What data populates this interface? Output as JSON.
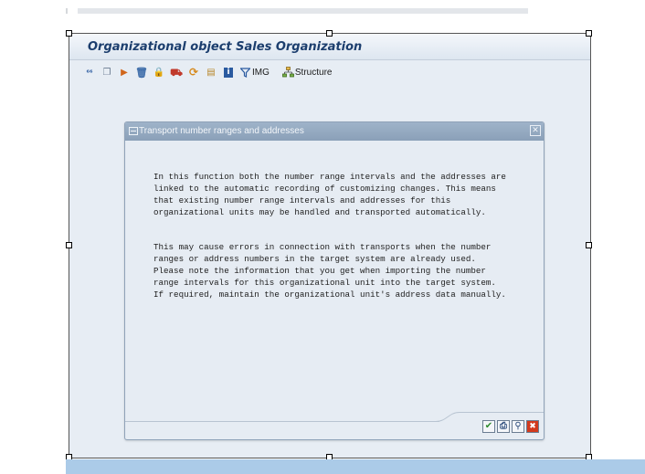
{
  "window": {
    "title": "Organizational object Sales Organization"
  },
  "toolbar": {
    "buttons": [
      {
        "icon": "display-change-icon",
        "glyph": "⁶⁶"
      },
      {
        "icon": "copy-icon",
        "glyph": "❐"
      },
      {
        "icon": "transport-icon",
        "glyph": "▶"
      },
      {
        "icon": "delete-icon",
        "glyph": "🗑"
      },
      {
        "icon": "lock-icon",
        "glyph": "🔒"
      },
      {
        "icon": "transport-truck-icon",
        "glyph": "⛟"
      },
      {
        "icon": "refresh-icon",
        "glyph": "⟳"
      },
      {
        "icon": "document-icon",
        "glyph": "▤"
      },
      {
        "icon": "info-icon",
        "glyph": "i"
      }
    ],
    "img_label": "IMG",
    "structure_label": "Structure"
  },
  "dialog": {
    "title": "Transport number ranges and addresses",
    "close_glyph": "✕",
    "paragraph1": [
      "In this function both the number range intervals and the addresses are",
      "linked to the automatic recording of customizing changes. This means",
      "that existing number range intervals and addresses for this",
      "organizational units may be handled and transported automatically."
    ],
    "paragraph2": [
      "This may cause errors in connection with transports when the number",
      "ranges or address numbers in the target system are already used.",
      "Please note the information that you get when importing the number",
      "range intervals for this organizational unit into the target system.",
      "If required, maintain the organizational unit's address data manually."
    ],
    "buttons": [
      {
        "icon": "confirm-check-icon",
        "glyph": "✔",
        "color": "#2e8b2e"
      },
      {
        "icon": "print-icon",
        "glyph": "⎙",
        "color": "#2a4a7a"
      },
      {
        "icon": "find-icon",
        "glyph": "⚲",
        "color": "#2a4a7a"
      },
      {
        "icon": "cancel-icon",
        "glyph": "✖",
        "color": "#d23a1e"
      }
    ]
  },
  "colors": {
    "title_text": "#1c3e6e",
    "window_background": "#e7edf4",
    "dialog_header": "#8aa0b8",
    "bottom_band": "#abcbe8"
  }
}
